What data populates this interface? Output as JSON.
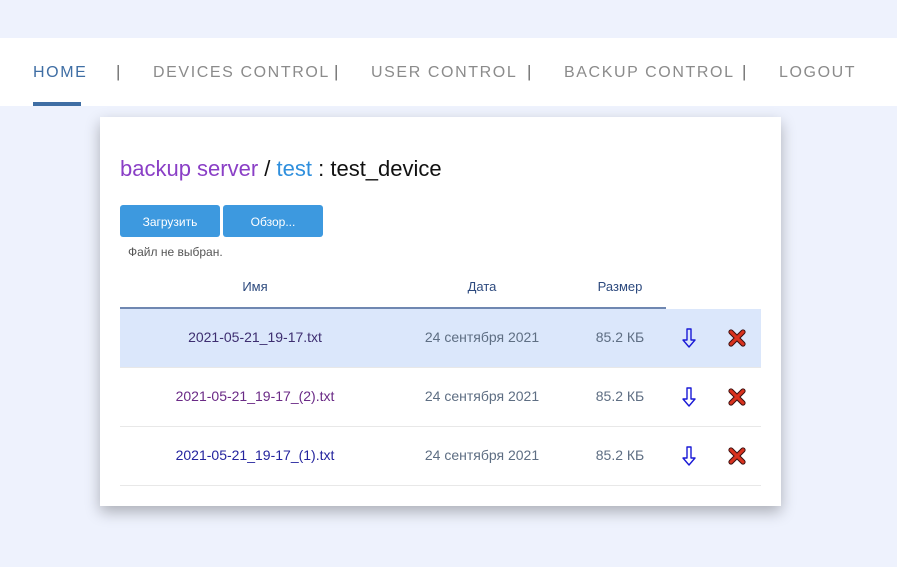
{
  "nav": {
    "items": [
      {
        "label": "HOME"
      },
      {
        "label": "DEVICES CONTROL"
      },
      {
        "label": "USER CONTROL"
      },
      {
        "label": "BACKUP CONTROL"
      },
      {
        "label": "LOGOUT"
      }
    ],
    "separator": "|"
  },
  "page": {
    "title_server": "backup server",
    "title_sep": " / ",
    "title_user": "test",
    "title_device_sep": " : ",
    "title_device": "test_device"
  },
  "upload": {
    "upload_label": "Загрузить",
    "browse_label": "Обзор...",
    "status": "Файл не выбран."
  },
  "table": {
    "headers": {
      "name": "Имя",
      "date": "Дата",
      "size": "Размер"
    },
    "rows": [
      {
        "name": "2021-05-21_19-17.txt",
        "date": "24 сентября 2021",
        "size": "85.2 КБ"
      },
      {
        "name": "2021-05-21_19-17_(2).txt",
        "date": "24 сентября 2021",
        "size": "85.2 КБ"
      },
      {
        "name": "2021-05-21_19-17_(1).txt",
        "date": "24 сентября 2021",
        "size": "85.2 КБ"
      }
    ],
    "selected_row": 0
  },
  "icons": {
    "download": "download-arrow-icon",
    "delete": "delete-x-icon"
  },
  "colors": {
    "page_bg": "#eef2fd",
    "nav_active": "#3f6ea4",
    "nav_inactive": "#8b8b8b",
    "button": "#3d99df",
    "selected_row": "#dbe7fb",
    "title_server": "#8a3fc6",
    "title_user": "#2f8fdd",
    "delete_icon": "#cc2a1a",
    "download_icon": "#1a1ad6"
  }
}
